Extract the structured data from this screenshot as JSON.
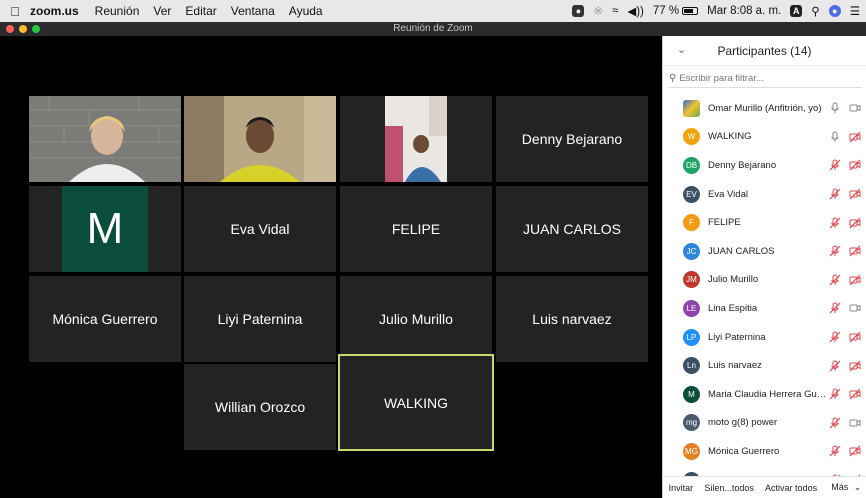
{
  "menubar": {
    "app": "zoom.us",
    "items": [
      "Reunión",
      "Ver",
      "Editar",
      "Ventana",
      "Ayuda"
    ],
    "battery": "77 %",
    "clock": "Mar 8:08 a. m.",
    "input_badge": "A"
  },
  "window": {
    "title": "Reunión de Zoom"
  },
  "tiles": {
    "t1": "",
    "t2": "",
    "t3": "",
    "t4": "Denny Bejarano",
    "t5": "M",
    "t6": "Eva Vidal",
    "t7": "FELIPE",
    "t8": "JUAN CARLOS",
    "t9": "Mónica Guerrero",
    "t10": "Liyi Paternina",
    "t11": "Julio Murillo",
    "t12": "Luis narvaez",
    "t13": "Willian Orozco",
    "t14": "WALKING"
  },
  "panel": {
    "title": "Participantes (14)",
    "search_placeholder": "Escribir para filtrar...",
    "participants": [
      {
        "initials": "",
        "name": "Omar Murillo (Anfitrión, yo)",
        "color": "#2f6fd6",
        "mic": "on",
        "video": "off-gray"
      },
      {
        "initials": "W",
        "name": "WALKING",
        "color": "#f0a30a",
        "mic": "on",
        "video": "muted"
      },
      {
        "initials": "DB",
        "name": "Denny Bejarano",
        "color": "#1fa463",
        "mic": "muted",
        "video": "muted"
      },
      {
        "initials": "EV",
        "name": "Eva Vidal",
        "color": "#3d4f66",
        "mic": "muted",
        "video": "muted"
      },
      {
        "initials": "F",
        "name": "FELIPE",
        "color": "#f39c12",
        "mic": "muted",
        "video": "muted"
      },
      {
        "initials": "JC",
        "name": "JUAN CARLOS",
        "color": "#2e86de",
        "mic": "muted",
        "video": "muted"
      },
      {
        "initials": "JM",
        "name": "Julio Murillo",
        "color": "#c0392b",
        "mic": "muted",
        "video": "muted"
      },
      {
        "initials": "LE",
        "name": "Lina Espitia",
        "color": "#8e44ad",
        "mic": "muted",
        "video": "off-gray"
      },
      {
        "initials": "LP",
        "name": "Liyi Paternina",
        "color": "#1e90ff",
        "mic": "muted",
        "video": "muted"
      },
      {
        "initials": "Ln",
        "name": "Luis narvaez",
        "color": "#3d4f66",
        "mic": "muted",
        "video": "muted"
      },
      {
        "initials": "M",
        "name": "Maria Claudia Herrera Guz...",
        "color": "#0b4d3b",
        "mic": "muted",
        "video": "muted"
      },
      {
        "initials": "mg",
        "name": "moto g(8) power",
        "color": "#4a5a70",
        "mic": "muted",
        "video": "off-gray"
      },
      {
        "initials": "MG",
        "name": "Mónica Guerrero",
        "color": "#e67e22",
        "mic": "muted",
        "video": "muted"
      },
      {
        "initials": "",
        "name": "",
        "color": "#3d4f66",
        "mic": "muted",
        "video": "muted"
      }
    ],
    "footer": {
      "invite": "Invitar",
      "mute_all": "Silen...todos",
      "unmute_all": "Activar todos",
      "more": "Más"
    }
  }
}
